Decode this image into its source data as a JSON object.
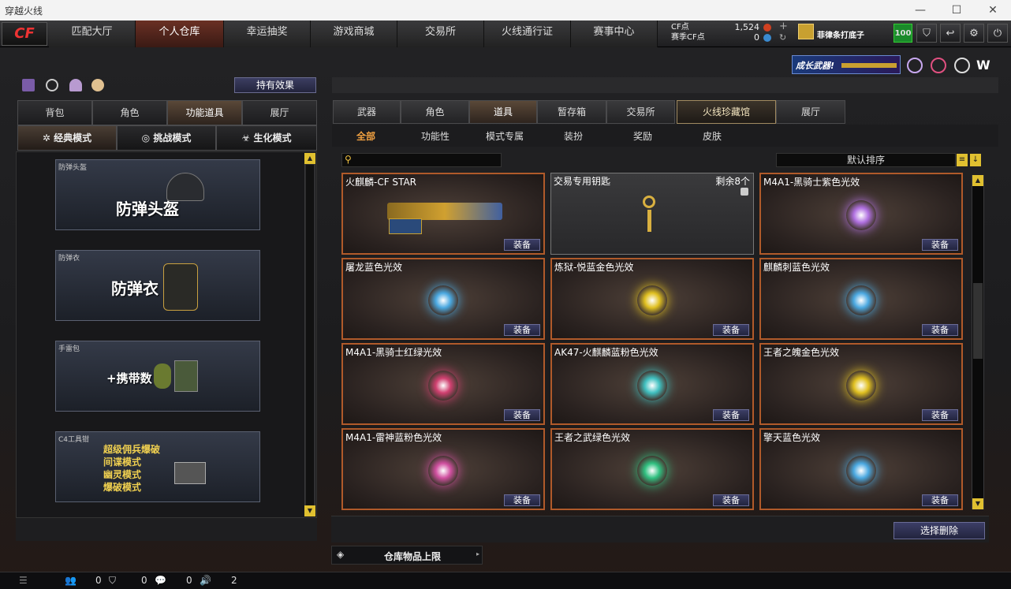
{
  "window": {
    "title": "穿越火线",
    "minimize": "—",
    "maximize": "☐",
    "close": "✕"
  },
  "nav": {
    "logo": "CF",
    "tabs": [
      {
        "label": "匹配大厅"
      },
      {
        "label": "个人仓库"
      },
      {
        "label": "幸运抽奖"
      },
      {
        "label": "游戏商城"
      },
      {
        "label": "交易所"
      },
      {
        "label": "火线通行证"
      },
      {
        "label": "赛事中心"
      }
    ],
    "cf_label": "CF点",
    "cf_value": "1,524",
    "season_cf_label": "赛季CF点",
    "season_cf_value": "0",
    "username": "菲律条打底子",
    "level": "100"
  },
  "left": {
    "hold_effect": "持有效果",
    "tabs": [
      {
        "label": "背包"
      },
      {
        "label": "角色"
      },
      {
        "label": "功能道具"
      },
      {
        "label": "展厅"
      }
    ],
    "modes": [
      {
        "label": "经典模式"
      },
      {
        "label": "挑战模式"
      },
      {
        "label": "生化模式"
      }
    ],
    "cards": [
      {
        "label": "防弹头盔",
        "big": "防弹头盔"
      },
      {
        "label": "防弹衣",
        "big": "防弹衣"
      },
      {
        "label": "手雷包",
        "big": "+携带数"
      },
      {
        "label": "C4工具钳",
        "lines": [
          "超级佣兵爆破",
          "间谍模式",
          "幽灵模式",
          "爆破模式"
        ]
      }
    ]
  },
  "banner": {
    "text": "成长武器!"
  },
  "right": {
    "tabs": [
      {
        "label": "武器"
      },
      {
        "label": "角色"
      },
      {
        "label": "道具"
      },
      {
        "label": "暂存箱"
      },
      {
        "label": "交易所"
      },
      {
        "label": "火线珍藏馆"
      },
      {
        "label": "展厅"
      }
    ],
    "subtabs": [
      {
        "label": "全部"
      },
      {
        "label": "功能性"
      },
      {
        "label": "模式专属"
      },
      {
        "label": "装扮"
      },
      {
        "label": "奖励"
      },
      {
        "label": "皮肤"
      }
    ],
    "sort": "默认排序",
    "items": [
      {
        "name": "火麒麟-CF STAR",
        "equip": "装备",
        "color": "#c9a030"
      },
      {
        "name": "交易专用钥匙",
        "remain": "剩余8个",
        "color": "#d9b040"
      },
      {
        "name": "M4A1-黑骑士紫色光效",
        "equip": "装备",
        "color": "#b070e0"
      },
      {
        "name": "屠龙蓝色光效",
        "equip": "装备",
        "color": "#4aa8e0"
      },
      {
        "name": "炼狱-悦蓝金色光效",
        "equip": "装备",
        "color": "#e0c020"
      },
      {
        "name": "麒麟刺蓝色光效",
        "equip": "装备",
        "color": "#4aa8e0"
      },
      {
        "name": "M4A1-黑骑士红绿光效",
        "equip": "装备",
        "color": "#d04070"
      },
      {
        "name": "AK47-火麒麟蓝粉色光效",
        "equip": "装备",
        "color": "#40c0c0"
      },
      {
        "name": "王者之魄金色光效",
        "equip": "装备",
        "color": "#e0c020"
      },
      {
        "name": "M4A1-雷神蓝粉色光效",
        "equip": "装备",
        "color": "#d050a0"
      },
      {
        "name": "王者之武绿色光效",
        "equip": "装备",
        "color": "#30c080"
      },
      {
        "name": "擎天蓝色光效",
        "equip": "装备",
        "color": "#4aa8e0"
      }
    ],
    "select_delete": "选择删除",
    "capacity": "仓库物品上限"
  },
  "status": {
    "friends": "0",
    "guild": "0",
    "messages": "0",
    "volume": "2"
  }
}
